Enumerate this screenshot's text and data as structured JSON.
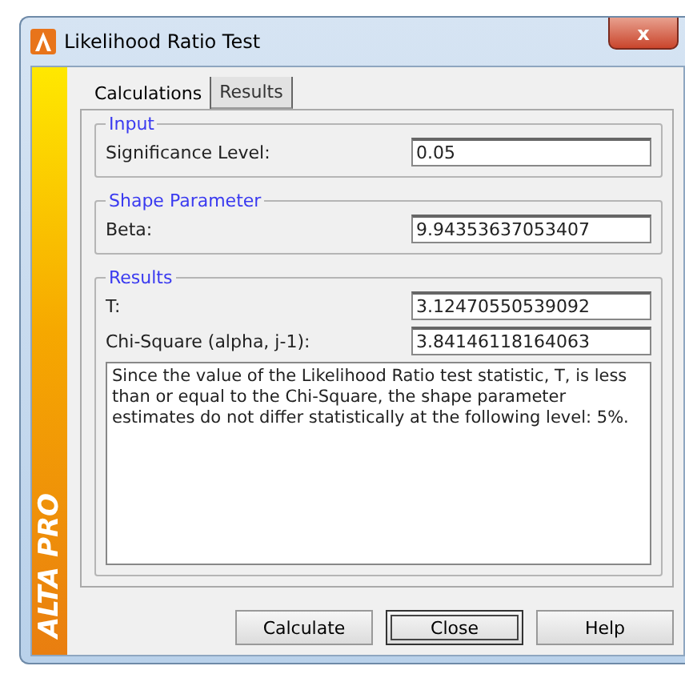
{
  "window": {
    "title": "Likelihood Ratio Test",
    "close_glyph": "x"
  },
  "sidebar": {
    "brand": "ALTA PRO"
  },
  "tabs": [
    {
      "label": "Calculations",
      "selected": true
    },
    {
      "label": "Results",
      "selected": false
    }
  ],
  "groups": [
    {
      "title": "Input",
      "fields": [
        {
          "label": "Significance Level:",
          "value": "0.05"
        }
      ]
    },
    {
      "title": "Shape Parameter",
      "fields": [
        {
          "label": "Beta:",
          "value": "9.94353637053407"
        }
      ]
    },
    {
      "title": "Results",
      "fields": [
        {
          "label": "T:",
          "value": "3.12470550539092"
        },
        {
          "label": "Chi-Square (alpha, j-1):",
          "value": "3.84146118164063"
        }
      ],
      "message": "Since the value of the Likelihood Ratio test statistic, T, is less than or equal to the Chi-Square, the shape parameter estimates do not differ statistically at the following level: 5%."
    }
  ],
  "buttons": [
    {
      "label": "Calculate",
      "default": false
    },
    {
      "label": "Close",
      "default": true
    },
    {
      "label": "Help",
      "default": false
    }
  ]
}
